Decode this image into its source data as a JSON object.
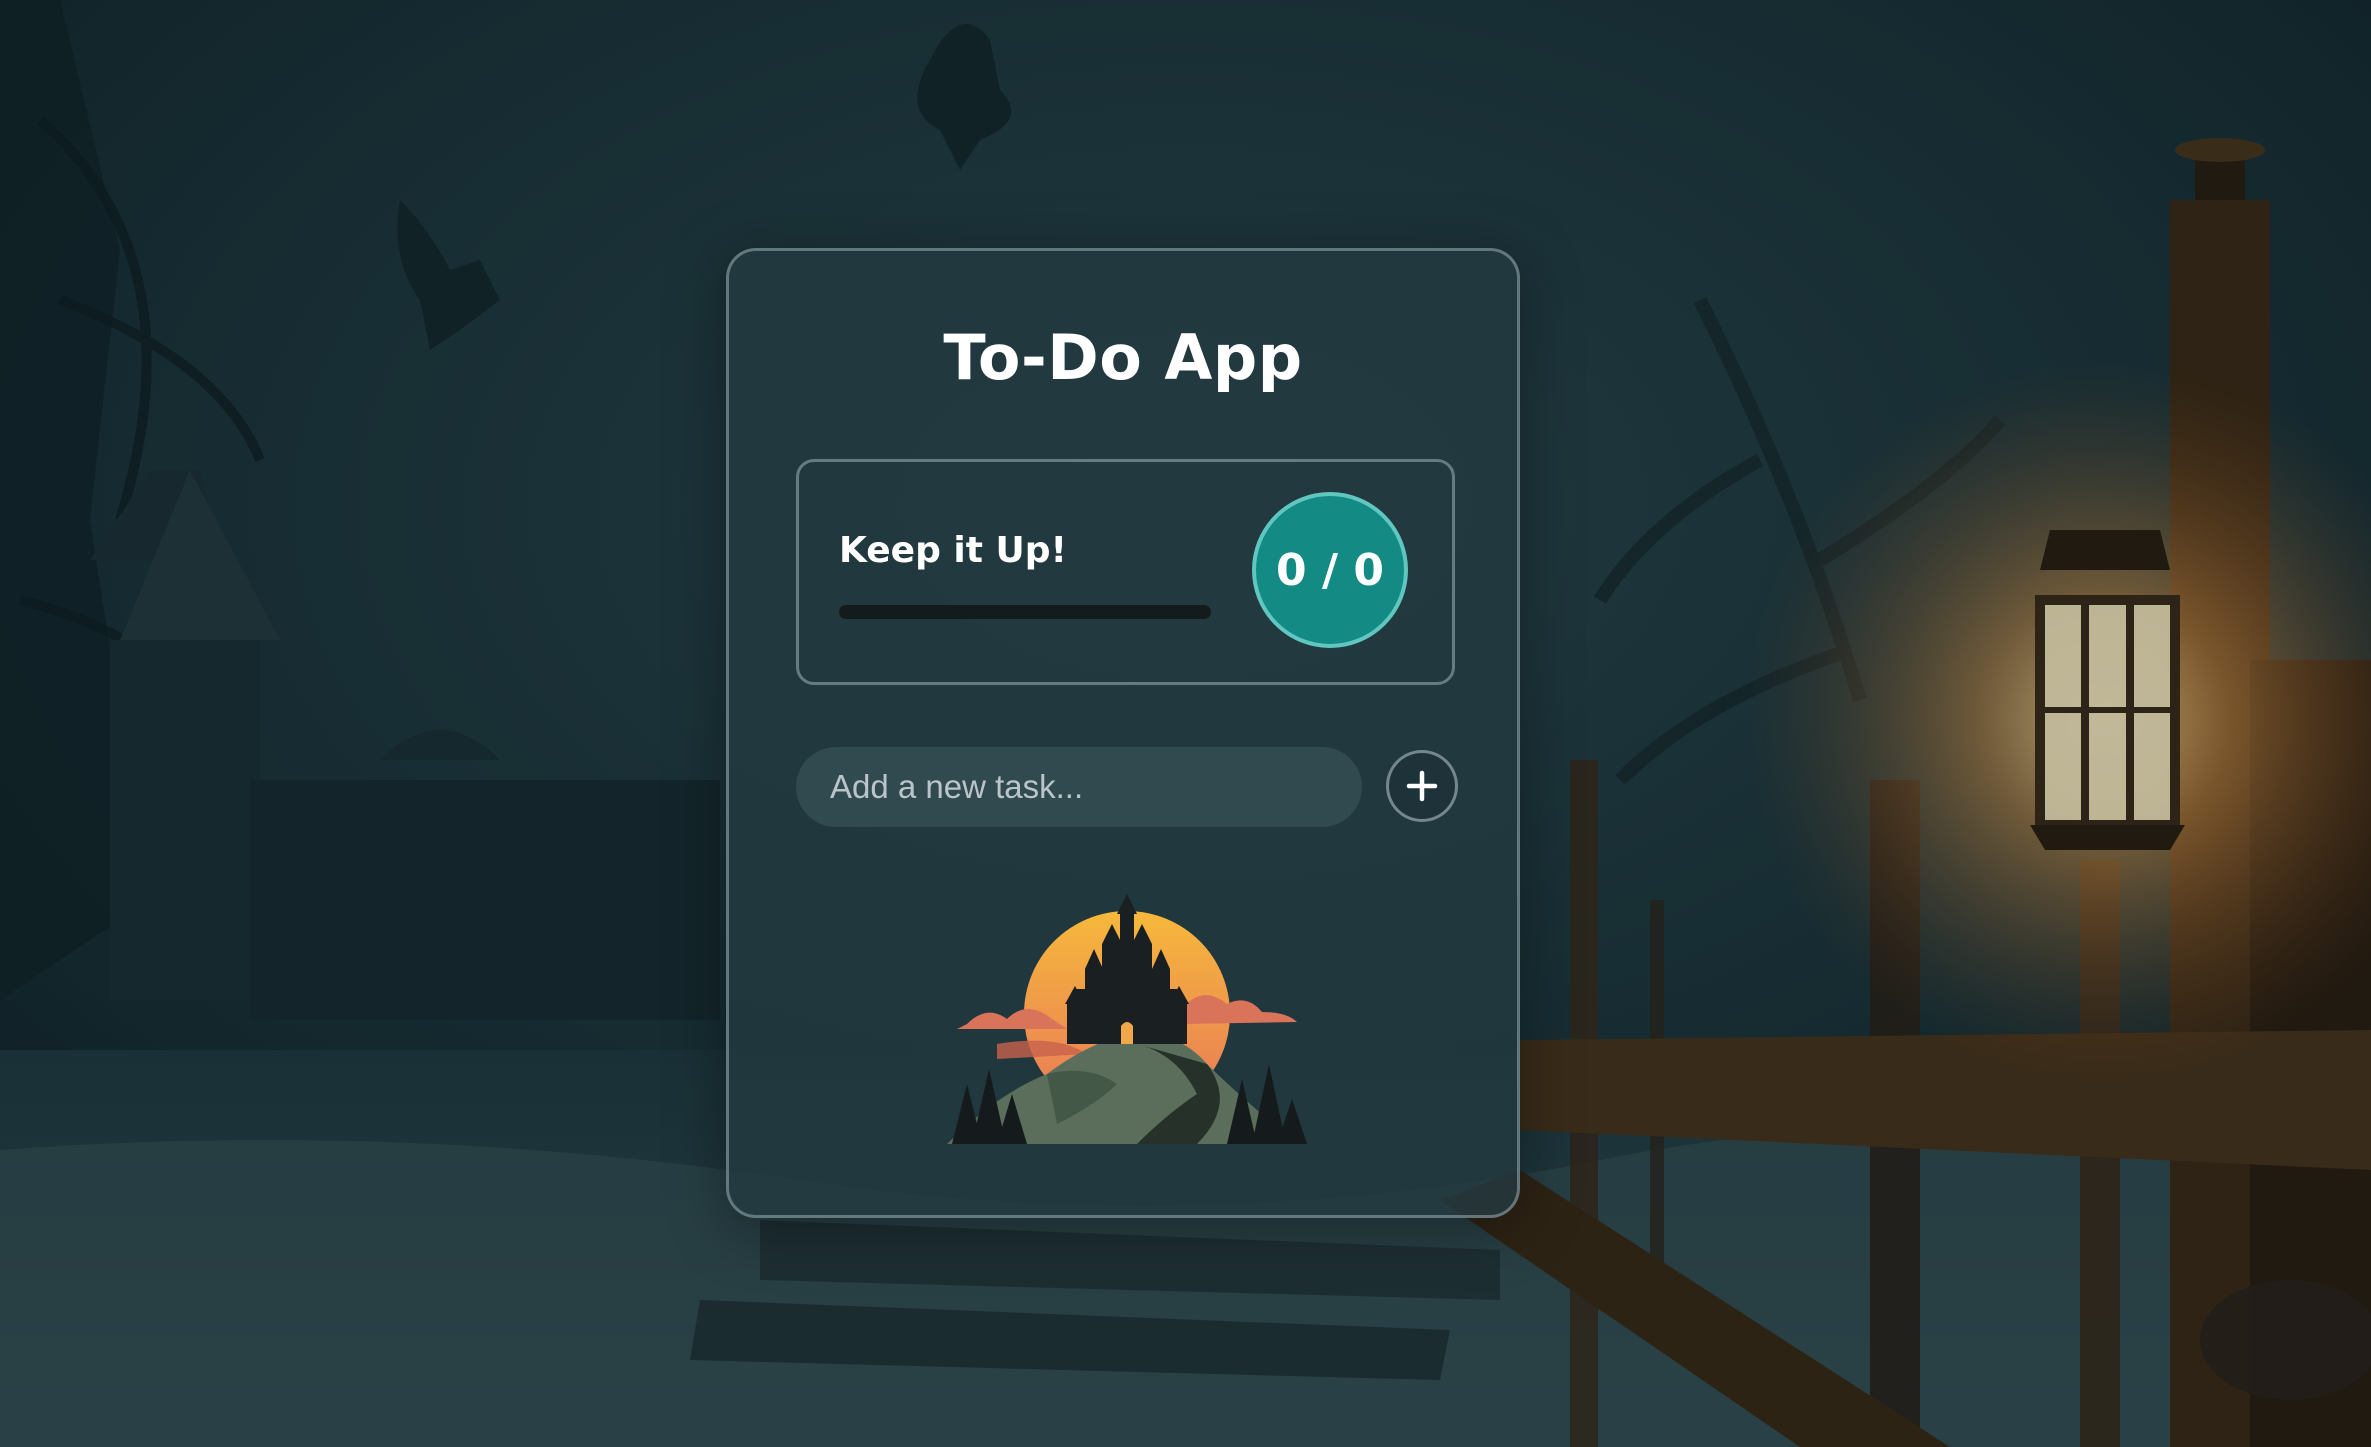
{
  "app": {
    "title": "To-Do App"
  },
  "stats": {
    "label": "Keep it Up!",
    "completed": 0,
    "total": 0,
    "counter_text": "0 / 0",
    "progress_fraction": 0
  },
  "new_task": {
    "placeholder": "Add a new task...",
    "value": "",
    "add_icon": "plus-icon"
  },
  "tasks": [],
  "colors": {
    "accent": "#138a84",
    "accent_ring": "#5fc7c0",
    "progress_track": "#141b1d",
    "logo_sun_top": "#f6b93b",
    "logo_sun_bottom": "#e8765a"
  }
}
